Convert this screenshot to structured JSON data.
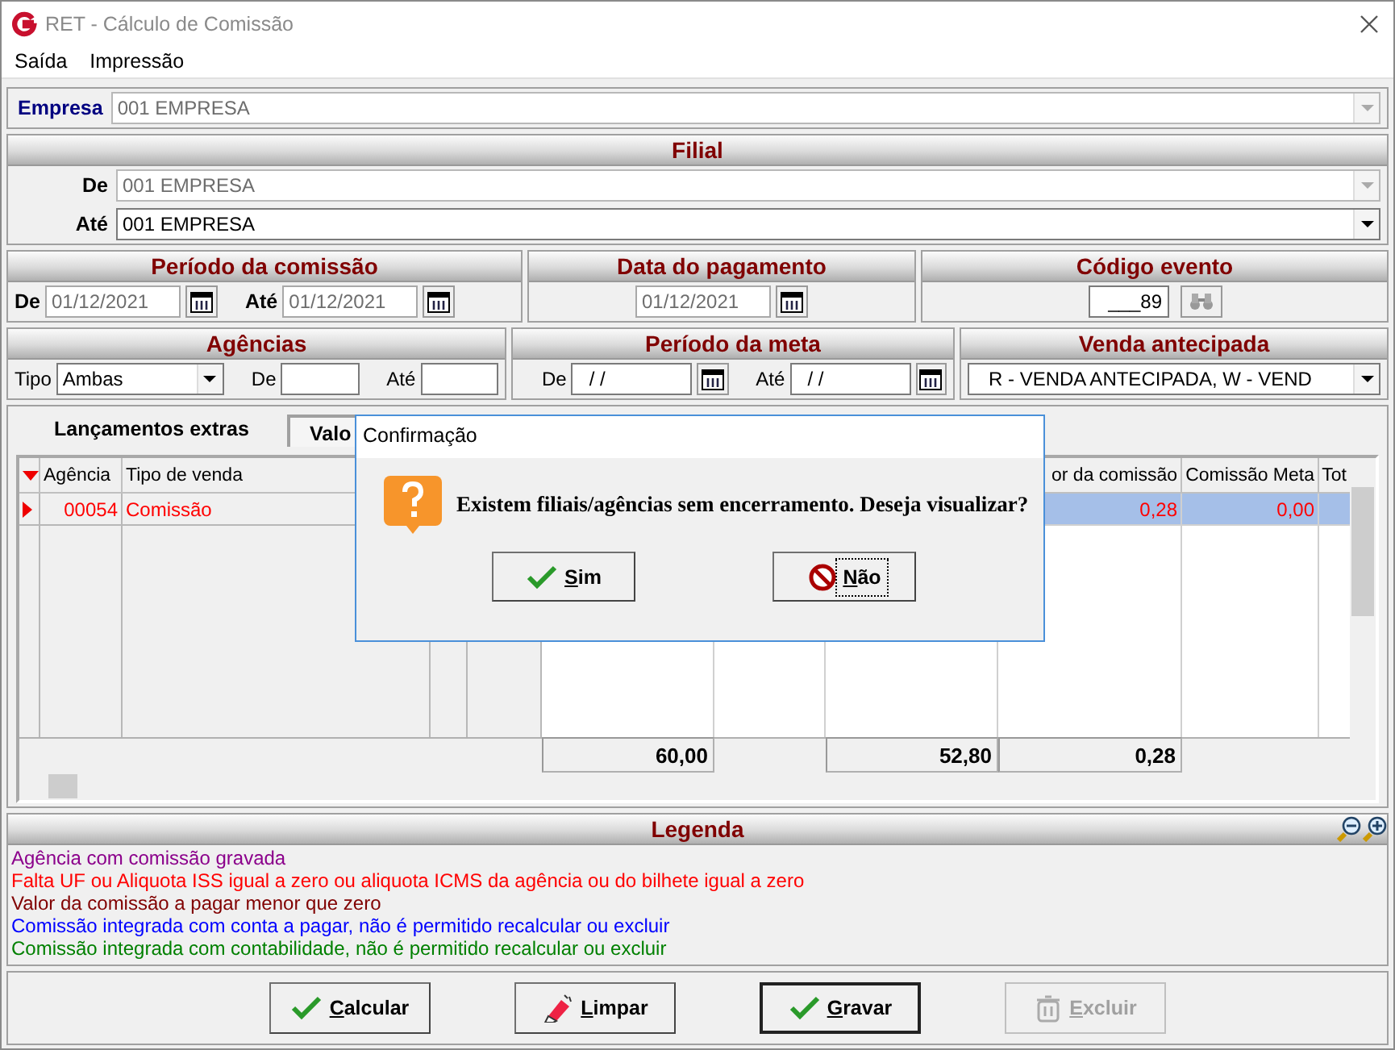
{
  "window": {
    "title": "RET - Cálculo de Comissão"
  },
  "menu": [
    "Saída",
    "Impressão"
  ],
  "empresa": {
    "label": "Empresa",
    "value": "001 EMPRESA",
    "disabled": true
  },
  "filial": {
    "title": "Filial",
    "de": {
      "label": "De",
      "value": "001 EMPRESA",
      "disabled": true
    },
    "ate": {
      "label": "Até",
      "value": "001 EMPRESA",
      "disabled": false
    }
  },
  "periodo_comissao": {
    "title": "Período da comissão",
    "de": {
      "label": "De",
      "value": "01/12/2021"
    },
    "ate": {
      "label": "Até",
      "value": "01/12/2021"
    }
  },
  "data_pagamento": {
    "title": "Data do pagamento",
    "value": "01/12/2021"
  },
  "codigo_evento": {
    "title": "Código evento",
    "value": "___89"
  },
  "agencias": {
    "title": "Agências",
    "tipo": {
      "label": "Tipo",
      "value": "Ambas"
    },
    "de": {
      "label": "De"
    },
    "ate": {
      "label": "Até"
    }
  },
  "periodo_meta": {
    "title": "Período da meta",
    "de": {
      "label": "De",
      "value": "/ /"
    },
    "ate": {
      "label": "Até",
      "value": "/ /"
    }
  },
  "venda_antecipada": {
    "title": "Venda antecipada",
    "value": "R - VENDA ANTECIPADA,  W - VEND"
  },
  "tabs": [
    {
      "label": "Lançamentos extras",
      "selected": true
    },
    {
      "label": "Valo",
      "selected": false
    }
  ],
  "grid": {
    "columns": [
      "Agência",
      "Tipo de venda",
      "or da comissão",
      "Comissão Meta",
      "Tot"
    ],
    "rows": [
      {
        "selected": true,
        "cells": [
          "00054",
          "Comissão",
          "0,28",
          "0,00"
        ]
      }
    ],
    "totals": [
      "60,00",
      "52,80",
      "0,28"
    ]
  },
  "legend": {
    "title": "Legenda",
    "items": [
      {
        "text": "Agência com comissão gravada",
        "color": "#8b008b"
      },
      {
        "text": "Falta UF ou Aliquota ISS igual a zero ou aliquota ICMS da agência ou do bilhete igual a zero",
        "color": "#ff0000"
      },
      {
        "text": "Valor da comissão a pagar menor que zero",
        "color": "#800000"
      },
      {
        "text": "Comissão integrada com conta a pagar, não é permitido recalcular ou excluir",
        "color": "#0000ff"
      },
      {
        "text": "Comissão integrada com contabilidade, não é permitido recalcular ou excluir",
        "color": "#008000"
      }
    ]
  },
  "buttons": [
    {
      "label": "Calcular",
      "kind": "check",
      "disabled": false,
      "default": false
    },
    {
      "label": "Limpar",
      "kind": "eraser",
      "disabled": false,
      "default": false
    },
    {
      "label": "Gravar",
      "kind": "check",
      "disabled": false,
      "default": true
    },
    {
      "label": "Excluir",
      "kind": "trash",
      "disabled": true,
      "default": false
    }
  ],
  "dialog": {
    "title": "Confirmação",
    "message": "Existem filiais/agências sem encerramento. Deseja visualizar?",
    "buttons": [
      {
        "label": "Sim",
        "kind": "check",
        "focused": false
      },
      {
        "label": "Não",
        "kind": "stop",
        "focused": true
      }
    ]
  }
}
